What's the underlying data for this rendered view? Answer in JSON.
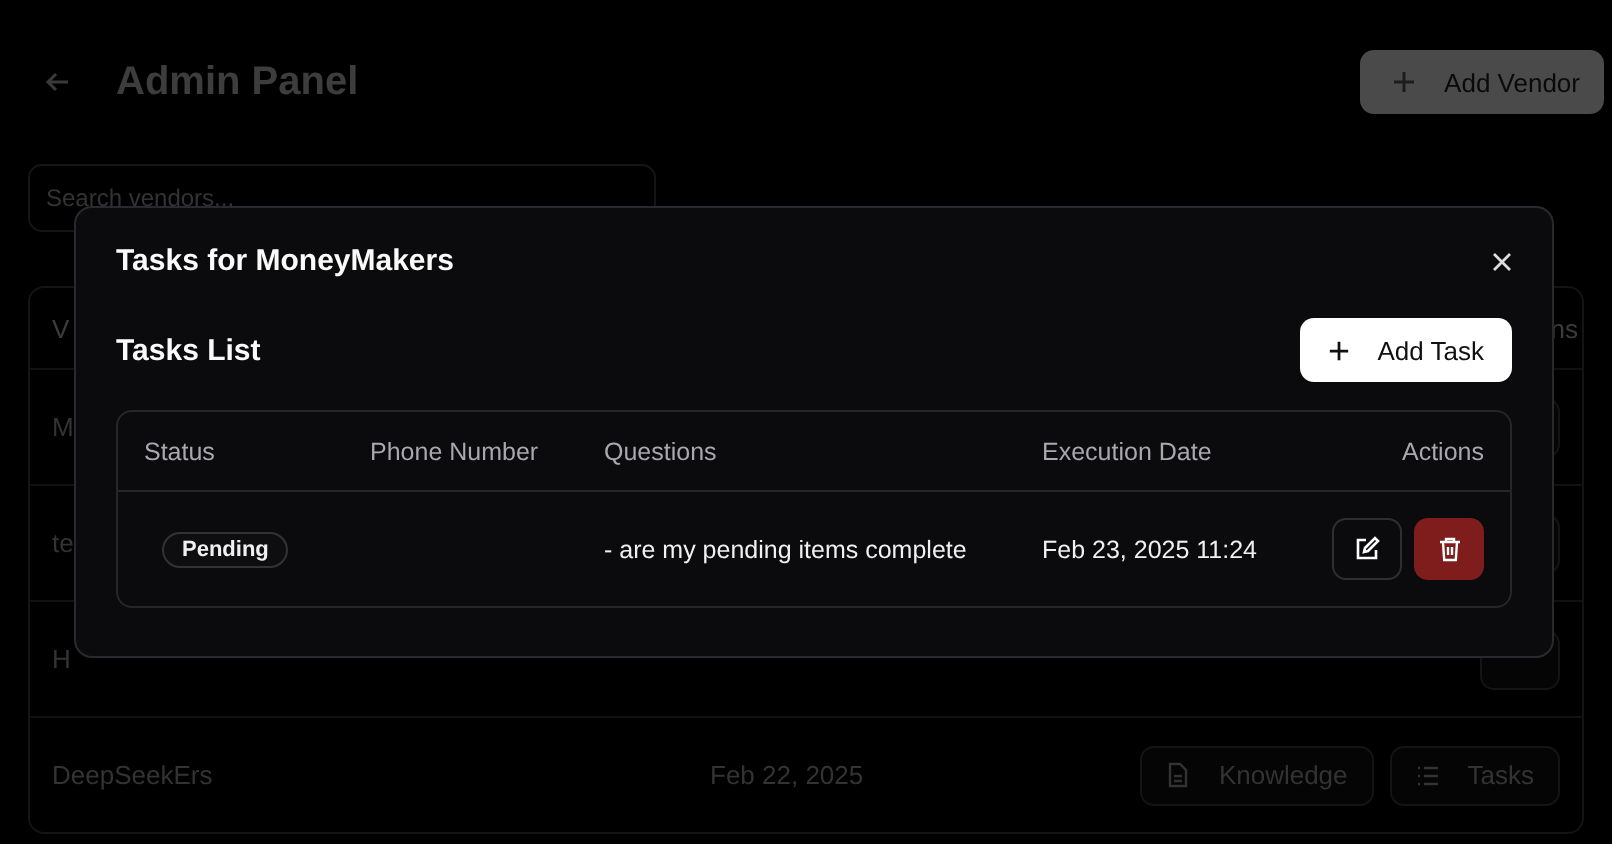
{
  "header": {
    "title": "Admin Panel",
    "add_button": "Add Vendor"
  },
  "search": {
    "placeholder": "Search vendors..."
  },
  "vendors_table": {
    "columns": [
      "V",
      "ns"
    ],
    "rows": [
      {
        "name": "M"
      },
      {
        "name": "te"
      },
      {
        "name": "H"
      },
      {
        "name": "DeepSeekErs",
        "date": "Feb 22, 2025",
        "knowledge_button": "Knowledge",
        "tasks_button": "Tasks"
      }
    ]
  },
  "dialog": {
    "title": "Tasks for MoneyMakers",
    "list_title": "Tasks List",
    "add_button": "Add Task",
    "columns": [
      "Status",
      "Phone Number",
      "Questions",
      "Execution Date",
      "Actions"
    ],
    "rows": [
      {
        "status": "Pending",
        "questions": "- are my pending items complete",
        "execution_date": "Feb 23, 2025 11:24"
      }
    ]
  }
}
